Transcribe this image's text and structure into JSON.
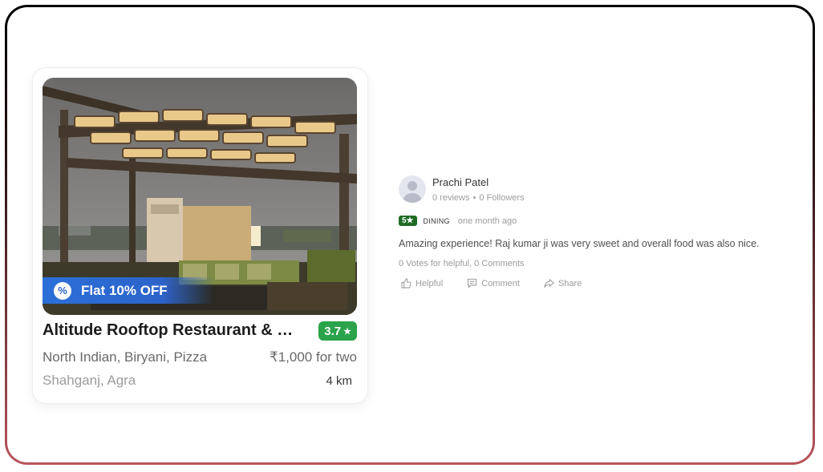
{
  "card": {
    "offer_text": "Flat 10% OFF",
    "offer_icon": "percent-badge-icon",
    "title": "Altitude Rooftop Restaurant & Lounge",
    "rating": "3.7",
    "rating_icon": "star-icon",
    "cuisine": "North Indian, Biryani, Pizza",
    "price": "₹1,000 for two",
    "locality": "Shahganj, Agra",
    "distance": "4 km",
    "colors": {
      "offer": "#2d63c9",
      "rating": "#2aa34a"
    }
  },
  "review": {
    "reviewer_name": "Prachi Patel",
    "reviews_count": "0 reviews",
    "separator": "•",
    "followers": "0 Followers",
    "stars": "5★",
    "type": "DINING",
    "time": "one month ago",
    "text": "Amazing experience! Raj kumar ji was very sweet and overall food was also nice.",
    "votes": "0 Votes for helpful, 0 Comments",
    "actions": {
      "helpful": "Helpful",
      "comment": "Comment",
      "share": "Share"
    },
    "colors": {
      "stars_badge": "#1f6b24"
    }
  }
}
